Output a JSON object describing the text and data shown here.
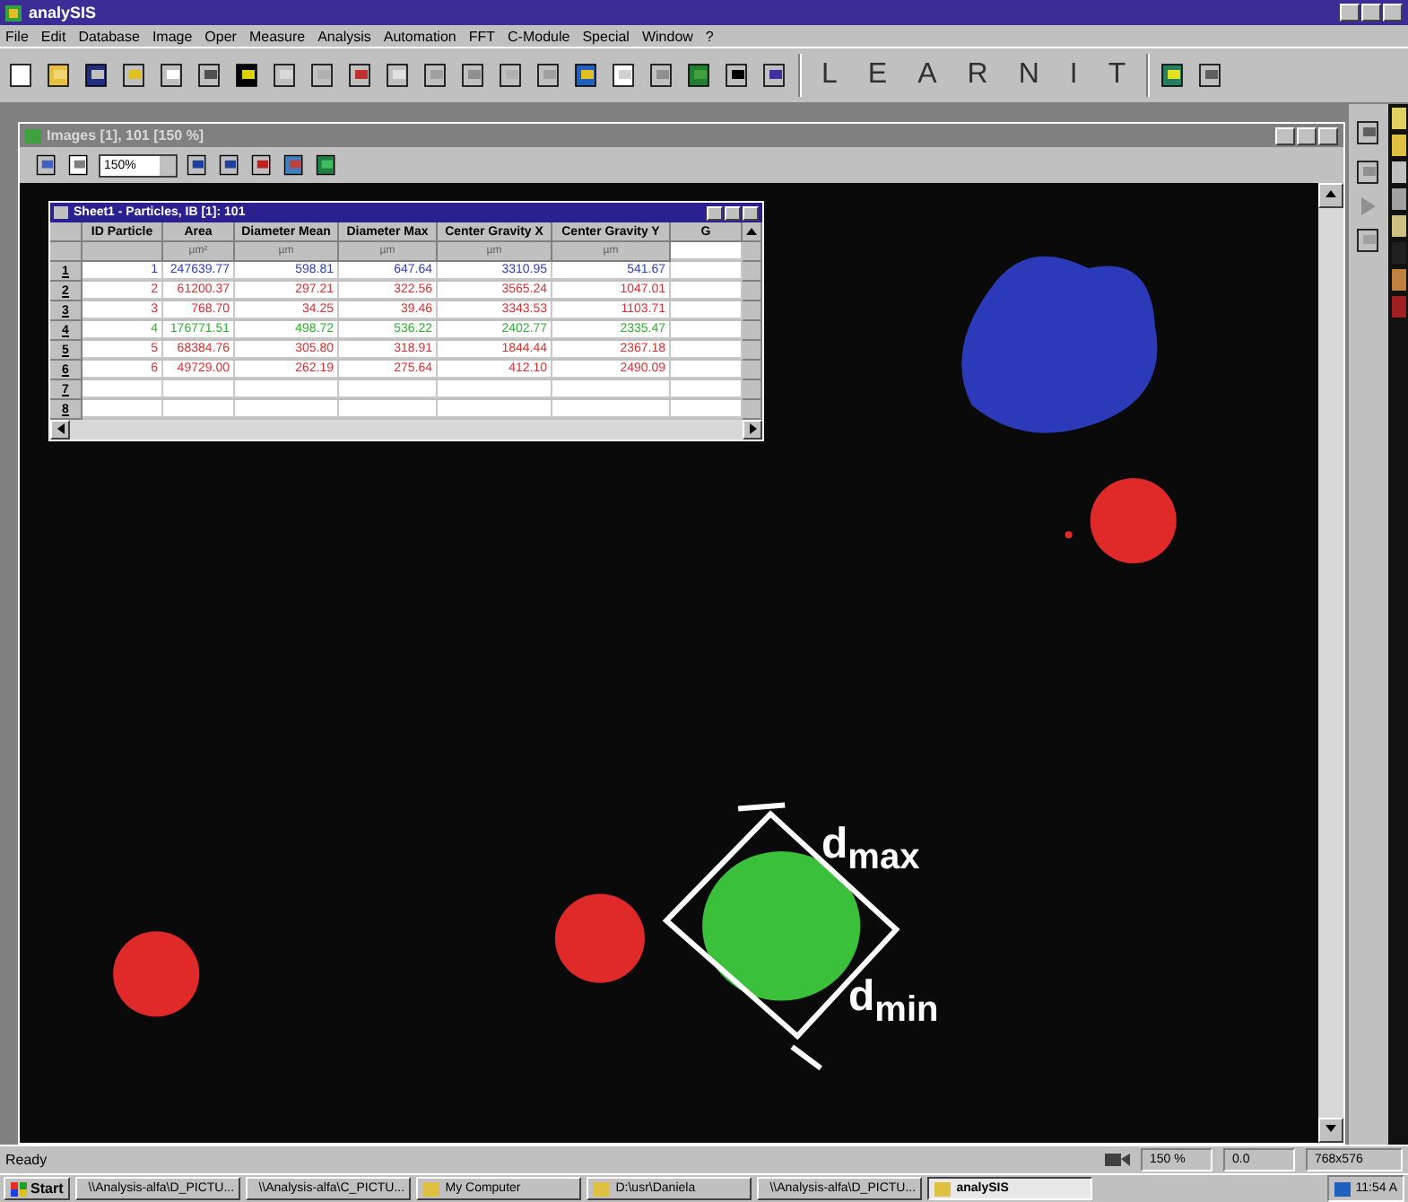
{
  "window": {
    "title": "analySIS"
  },
  "menu": [
    "File",
    "Edit",
    "Database",
    "Image",
    "Oper",
    "Measure",
    "Analysis",
    "Automation",
    "FFT",
    "C-Module",
    "Special",
    "Window",
    "?"
  ],
  "learn_it": [
    "L",
    "E",
    "A",
    "R",
    "N",
    "I",
    "T"
  ],
  "image_window": {
    "title": "Images [1], 101 [150 %]",
    "zoom": "150%"
  },
  "sheet": {
    "title": "Sheet1 - Particles, IB [1]: 101",
    "columns": [
      {
        "name": "ID Particle"
      },
      {
        "name": "Area",
        "unit": "µm²"
      },
      {
        "name": "Diameter Mean",
        "unit": "µm"
      },
      {
        "name": "Diameter Max",
        "unit": "µm"
      },
      {
        "name": "Center Gravity X",
        "unit": "µm"
      },
      {
        "name": "Center Gravity Y",
        "unit": "µm"
      },
      {
        "name": "G"
      }
    ],
    "rows": [
      {
        "num": "1",
        "color": "#3040c0",
        "cells": [
          "1",
          "247639.77",
          "598.81",
          "647.64",
          "3310.95",
          "541.67"
        ]
      },
      {
        "num": "2",
        "color": "#e03030",
        "cells": [
          "2",
          "61200.37",
          "297.21",
          "322.56",
          "3565.24",
          "1047.01"
        ]
      },
      {
        "num": "3",
        "color": "#e03030",
        "cells": [
          "3",
          "768.70",
          "34.25",
          "39.46",
          "3343.53",
          "1103.71"
        ]
      },
      {
        "num": "4",
        "color": "#30b030",
        "cells": [
          "4",
          "176771.51",
          "498.72",
          "536.22",
          "2402.77",
          "2335.47"
        ]
      },
      {
        "num": "5",
        "color": "#e03030",
        "cells": [
          "5",
          "68384.76",
          "305.80",
          "318.91",
          "1844.44",
          "2367.18"
        ]
      },
      {
        "num": "6",
        "color": "#e03030",
        "cells": [
          "6",
          "49729.00",
          "262.19",
          "275.64",
          "412.10",
          "2490.09"
        ]
      },
      {
        "num": "7",
        "cells": []
      },
      {
        "num": "8",
        "cells": []
      }
    ]
  },
  "annotations": [
    "d$_{max}$",
    "d$_{min}$"
  ],
  "status_bar": {
    "text": "Ready",
    "zoom": "150 %",
    "value": "0.0",
    "size": "768x576"
  },
  "taskbar": {
    "start": "Start",
    "items": [
      {
        "label": "\\\\Analysis-alfa\\D_PICTU...",
        "selected": false
      },
      {
        "label": "\\\\Analysis-alfa\\C_PICTU...",
        "selected": false
      },
      {
        "label": "My Computer",
        "selected": false
      },
      {
        "label": "D:\\usr\\Daniela",
        "selected": false
      },
      {
        "label": "\\\\Analysis-alfa\\D_PICTU...",
        "selected": false
      },
      {
        "label": "analySIS",
        "selected": true
      }
    ],
    "clock": "11:54 A"
  }
}
